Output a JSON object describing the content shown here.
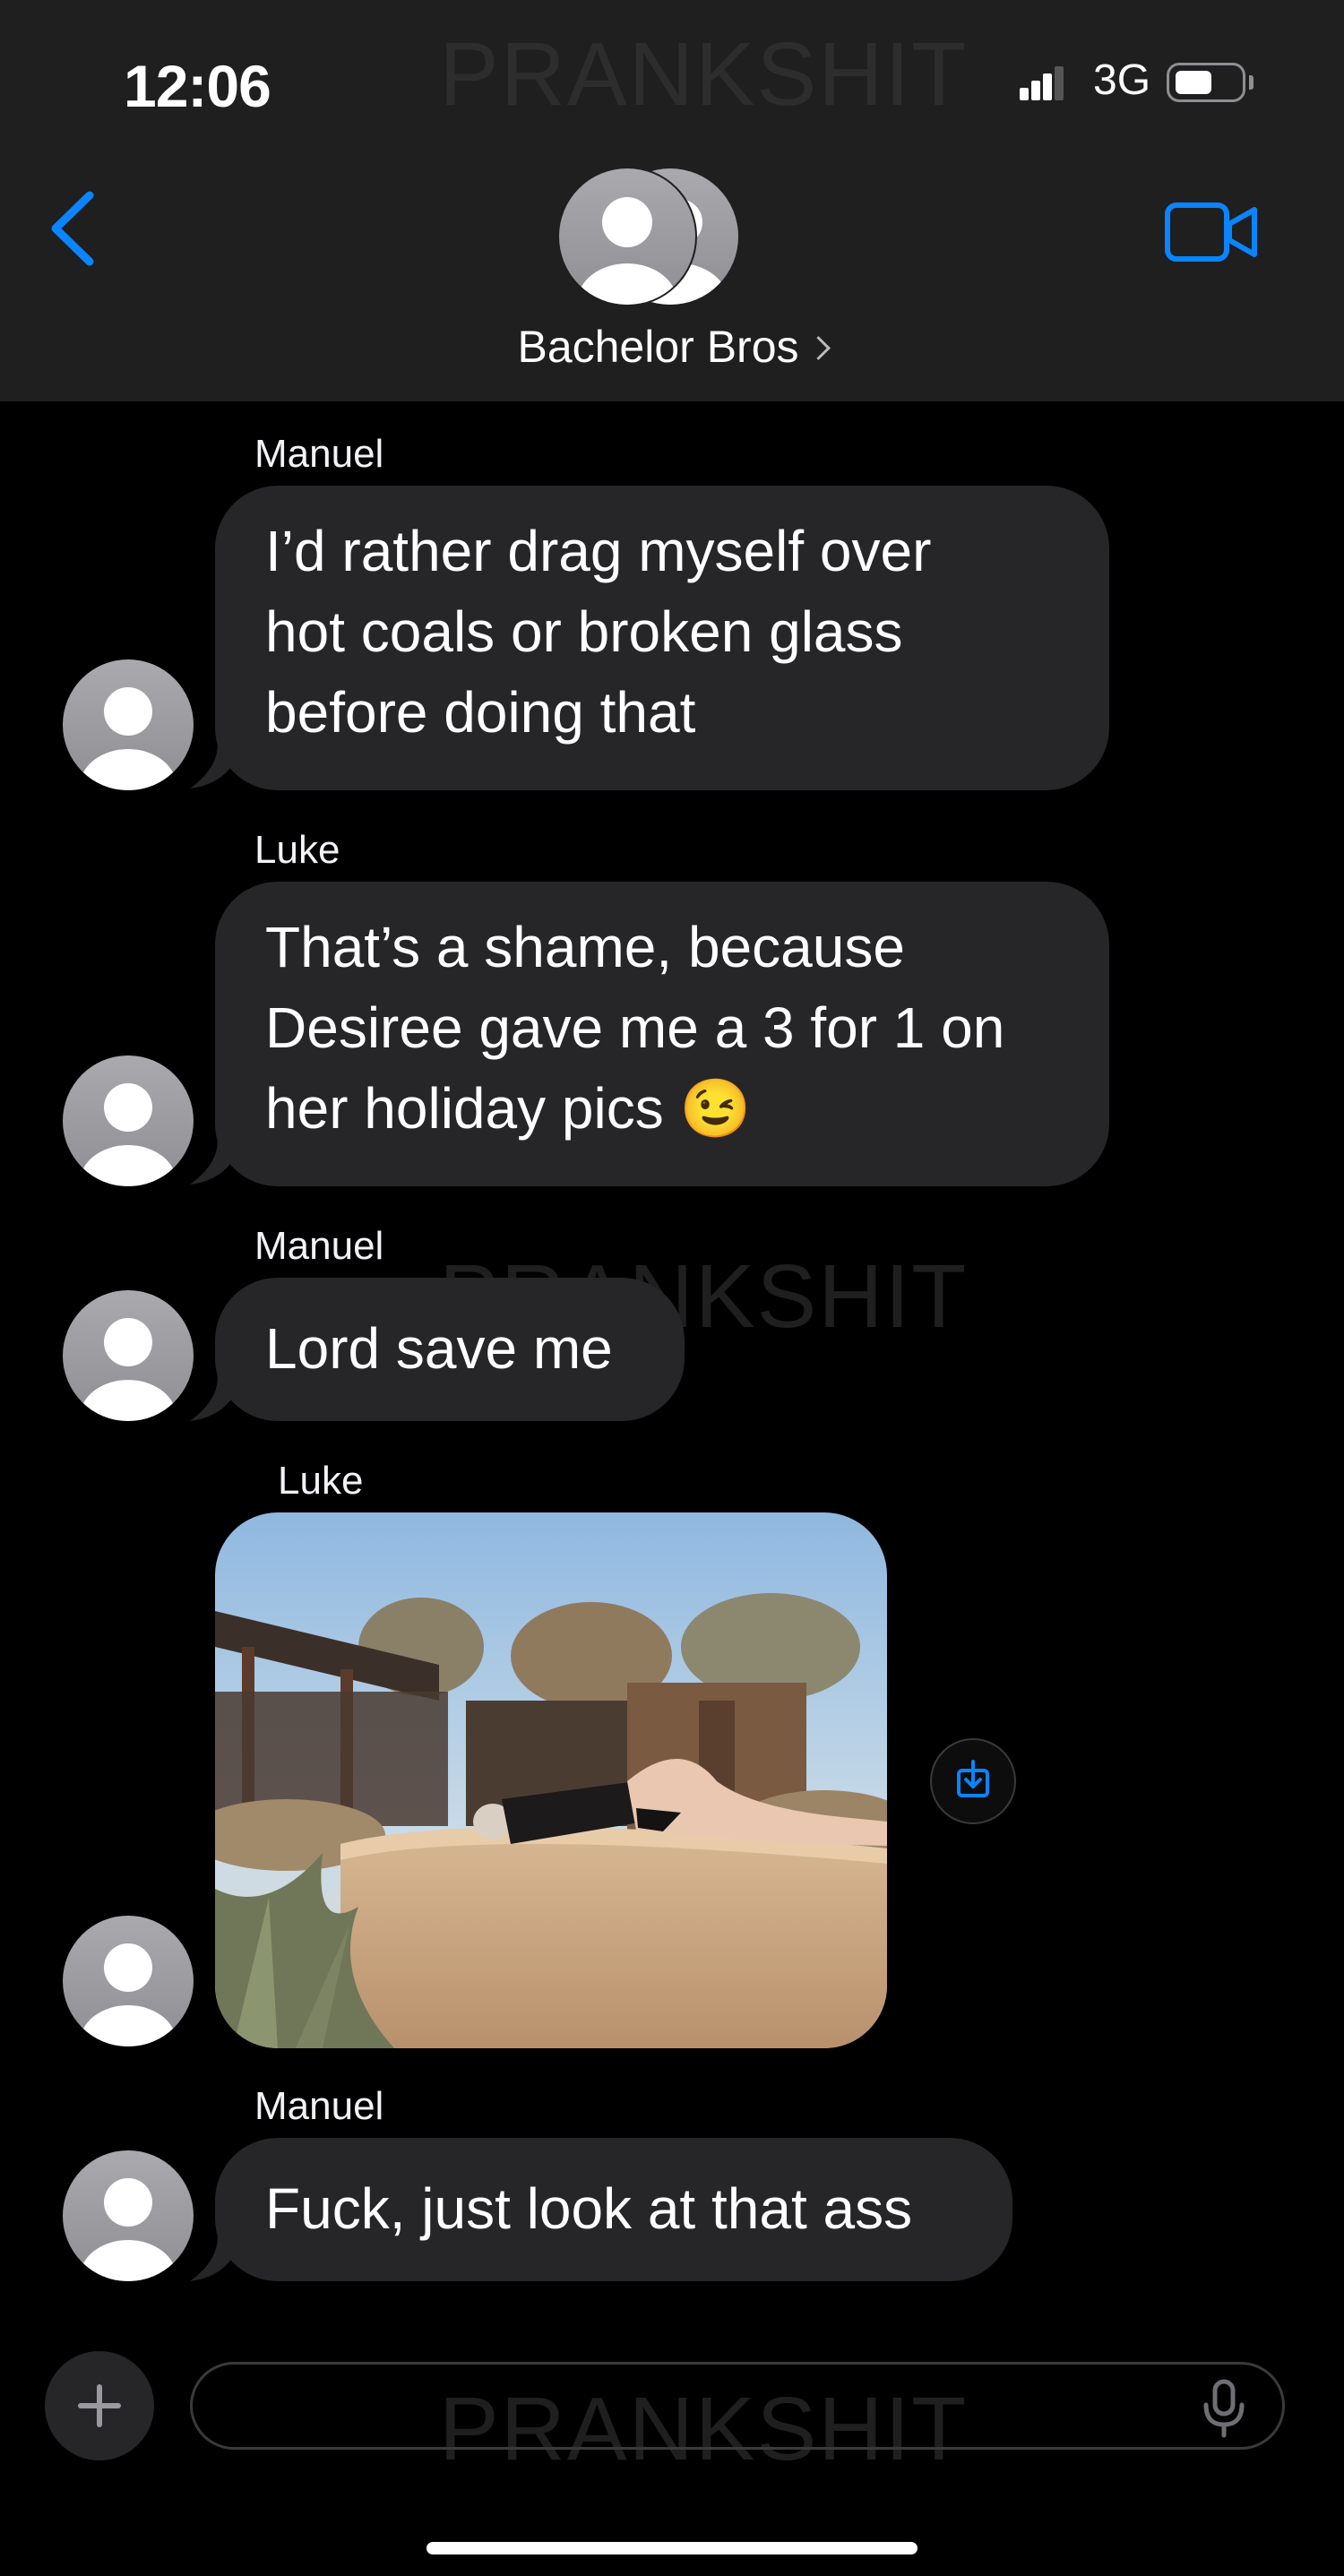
{
  "status_bar": {
    "time": "12:06",
    "network": "3G"
  },
  "watermark": "PRANKSHIT",
  "header": {
    "group_name": "Bachelor Bros"
  },
  "messages": [
    {
      "sender": "Manuel",
      "text": [
        "I’d rather drag myself over",
        "hot coals or broken glass",
        "before doing that"
      ]
    },
    {
      "sender": "Luke",
      "text": [
        "That’s a shame, because",
        "Desiree gave me a 3 for 1 on",
        "her holiday pics 😉"
      ]
    },
    {
      "sender": "Manuel",
      "text": [
        "Lord save me"
      ]
    },
    {
      "sender": "Luke",
      "type": "photo"
    },
    {
      "sender": "Manuel",
      "text": [
        "Fuck, just look at that ass"
      ]
    }
  ],
  "icons": [
    "back-chevron-icon",
    "video-camera-icon",
    "group-avatar-icon",
    "person-avatar-icon",
    "save-download-icon",
    "plus-icon",
    "microphone-icon"
  ],
  "colors": {
    "accent": "#0a84ff",
    "bubble": "#262628",
    "header": "#1f1f1f",
    "background": "#000000"
  }
}
